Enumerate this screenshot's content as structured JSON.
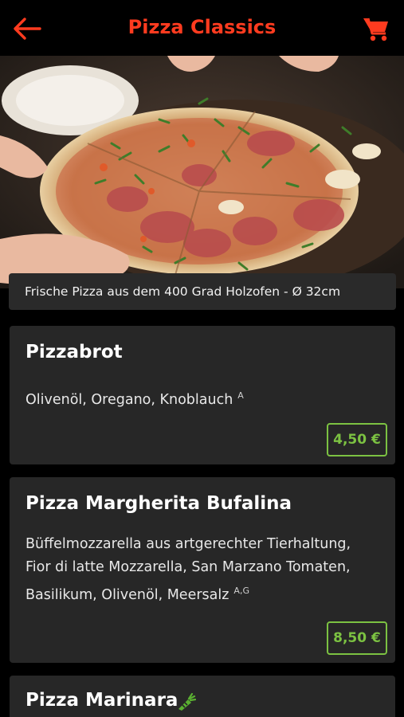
{
  "header": {
    "title": "Pizza Classics",
    "back_icon": "arrow-left-icon",
    "cart_icon": "shopping-cart-icon",
    "accent_color": "#ff3b1f"
  },
  "hero": {
    "caption": "Frische Pizza aus dem 400 Grad Holzofen - Ø 32cm"
  },
  "menu_items": [
    {
      "name": "Pizzabrot",
      "description_lines": [
        "Olivenöl, Oregano, Knoblauch"
      ],
      "allergens": "A",
      "price": "4,50 €"
    },
    {
      "name": "Pizza Margherita Bufalina",
      "description_lines": [
        "Büffelmozzarella aus artgerechter Tierhaltung,",
        "Fior di latte Mozzarella, San Marzano Tomaten,",
        "Basilikum, Olivenöl, Meersalz"
      ],
      "allergens": "A,G",
      "price": "8,50 €"
    },
    {
      "name": "Pizza Marinara",
      "badge_icon": "vegan-carrot-icon"
    }
  ],
  "colors": {
    "price_green": "#7cc242",
    "vegan_green": "#5ab031"
  }
}
